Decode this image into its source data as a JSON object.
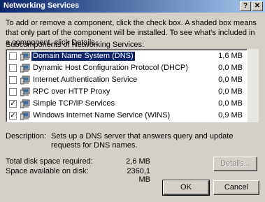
{
  "window": {
    "title": "Networking Services"
  },
  "intro_text": "To add or remove a component, click the check box. A shaded box means that only part of the component will be installed. To see what's included in a component, click Details.",
  "subcomponents_label": "Subcomponents of Networking Services:",
  "components": [
    {
      "name": "Domain Name System (DNS)",
      "size": "1,6 MB",
      "checked": false,
      "selected": true
    },
    {
      "name": "Dynamic Host Configuration Protocol (DHCP)",
      "size": "0,0 MB",
      "checked": false,
      "selected": false
    },
    {
      "name": "Internet Authentication Service",
      "size": "0,0 MB",
      "checked": false,
      "selected": false
    },
    {
      "name": "RPC over HTTP Proxy",
      "size": "0,0 MB",
      "checked": false,
      "selected": false
    },
    {
      "name": "Simple TCP/IP Services",
      "size": "0,0 MB",
      "checked": true,
      "selected": false
    },
    {
      "name": "Windows Internet Name Service (WINS)",
      "size": "0,9 MB",
      "checked": true,
      "selected": false
    }
  ],
  "description": {
    "label": "Description:",
    "text": "Sets up a DNS server that answers query and update requests for DNS names."
  },
  "disk": {
    "total_label": "Total disk space required:",
    "total_value": "2,6 MB",
    "available_label": "Space available on disk:",
    "available_value": "2360,1 MB"
  },
  "buttons": {
    "details": "Details...",
    "ok": "OK",
    "cancel": "Cancel"
  },
  "colors": {
    "titlebar_start": "#0a246a",
    "titlebar_end": "#a6caf0",
    "selection": "#0a246a",
    "face": "#d4d0c8"
  }
}
